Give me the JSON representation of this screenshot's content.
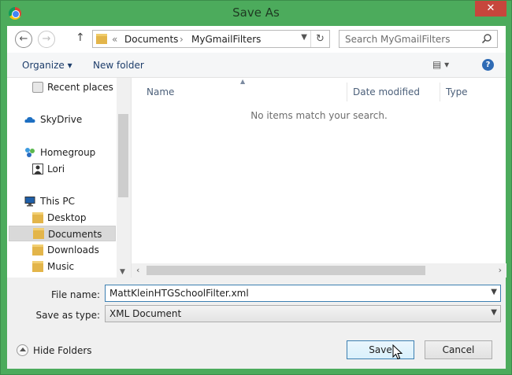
{
  "window": {
    "title": "Save As"
  },
  "address": {
    "separator": "«",
    "crumbs": [
      "Documents",
      "MyGmailFilters"
    ],
    "crumb_sep": "›"
  },
  "search": {
    "placeholder": "Search MyGmailFilters"
  },
  "toolbar": {
    "organize": "Organize ▾",
    "new_folder": "New folder",
    "view": "▤ ▾",
    "help": "?"
  },
  "nav": {
    "items": [
      {
        "label": "Recent places",
        "icon": "recent-places-icon"
      },
      {
        "label": "SkyDrive",
        "icon": "cloud-icon"
      },
      {
        "label": "Homegroup",
        "icon": "homegroup-icon"
      },
      {
        "label": "Lori",
        "icon": "user-icon"
      },
      {
        "label": "This PC",
        "icon": "computer-icon"
      },
      {
        "label": "Desktop",
        "icon": "folder-icon"
      },
      {
        "label": "Documents",
        "icon": "documents-folder-icon",
        "selected": true
      },
      {
        "label": "Downloads",
        "icon": "downloads-folder-icon"
      },
      {
        "label": "Music",
        "icon": "music-folder-icon"
      }
    ]
  },
  "files": {
    "columns": [
      "Name",
      "Date modified",
      "Type"
    ],
    "empty_message": "No items match your search."
  },
  "form": {
    "file_name_label": "File name:",
    "file_name_value": "MattKleinHTGSchoolFilter.xml",
    "save_type_label": "Save as type:",
    "save_type_value": "XML Document",
    "hide_folders": "Hide Folders",
    "save": "Save",
    "cancel": "Cancel"
  },
  "colors": {
    "window_frame": "#4cab5c",
    "close_button": "#c7463c",
    "selection": "#d9d9d9",
    "link_text": "#1e3e6b"
  }
}
